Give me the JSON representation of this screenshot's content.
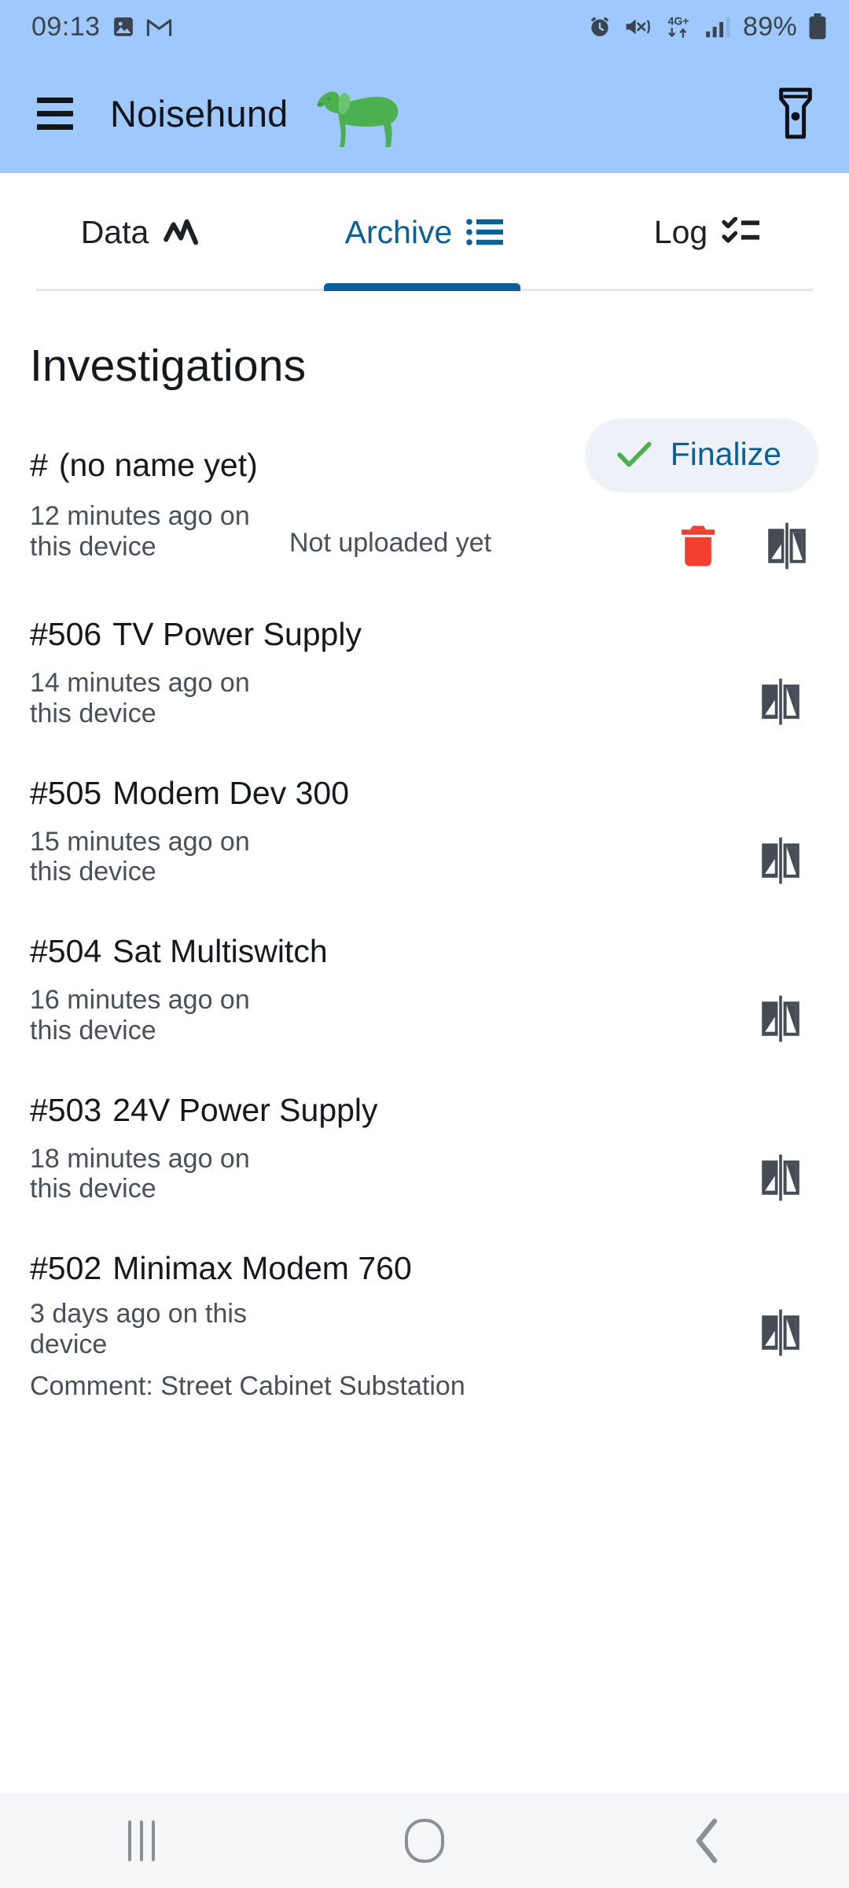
{
  "status_bar": {
    "clock": "09:13",
    "battery_percent": "89%",
    "icons": [
      "photos-icon",
      "gmail-icon",
      "alarm-icon",
      "mute-vibrate-icon",
      "4g-plus-data-icon",
      "signal-bars-icon",
      "battery-icon"
    ],
    "network_label": "4G+"
  },
  "app_bar": {
    "menu_icon": "hamburger-menu-icon",
    "title": "Noisehund",
    "logo_icon": "dachshund-logo",
    "logo_color": "#4caf50",
    "action_icon": "flashlight-icon",
    "background": "#9fc9fd"
  },
  "tabs": {
    "active_index": 1,
    "accent": "#0b6099",
    "items": [
      {
        "label": "Data",
        "icon": "line-chart-icon"
      },
      {
        "label": "Archive",
        "icon": "list-icon"
      },
      {
        "label": "Log",
        "icon": "checklist-icon"
      }
    ]
  },
  "main": {
    "page_title": "Investigations",
    "investigations": [
      {
        "number": "#",
        "name": "(no name yet)",
        "time": "12 minutes ago on this device",
        "upload_status": "Not uploaded yet",
        "comment": null,
        "has_finalize": true,
        "has_delete": true,
        "finalize_label": "Finalize"
      },
      {
        "number": "#506",
        "name": "TV Power Supply",
        "time": "14 minutes ago on this device",
        "upload_status": null,
        "comment": null,
        "has_finalize": false,
        "has_delete": false
      },
      {
        "number": "#505",
        "name": "Modem Dev 300",
        "time": "15 minutes ago on this device",
        "upload_status": null,
        "comment": null,
        "has_finalize": false,
        "has_delete": false
      },
      {
        "number": "#504",
        "name": "Sat Multiswitch",
        "time": "16 minutes ago on this device",
        "upload_status": null,
        "comment": null,
        "has_finalize": false,
        "has_delete": false
      },
      {
        "number": "#503",
        "name": "24V Power Supply",
        "time": "18 minutes ago on this device",
        "upload_status": null,
        "comment": null,
        "has_finalize": false,
        "has_delete": false
      },
      {
        "number": "#502",
        "name": "Minimax Modem 760",
        "time": "3 days ago on this device",
        "upload_status": null,
        "comment": "Comment: Street Cabinet Substation",
        "has_finalize": false,
        "has_delete": false
      }
    ],
    "row_icons": {
      "delete": "trash-icon",
      "compare": "compare-icon"
    },
    "colors": {
      "delete": "#f2402f",
      "compare": "#454c55",
      "check": "#4caf50",
      "finalize_bg": "#eef1f8",
      "finalize_text": "#0b6099"
    }
  },
  "nav_bar": {
    "items": [
      "recents-icon",
      "home-icon",
      "back-icon"
    ],
    "background": "#f4f6f8"
  }
}
